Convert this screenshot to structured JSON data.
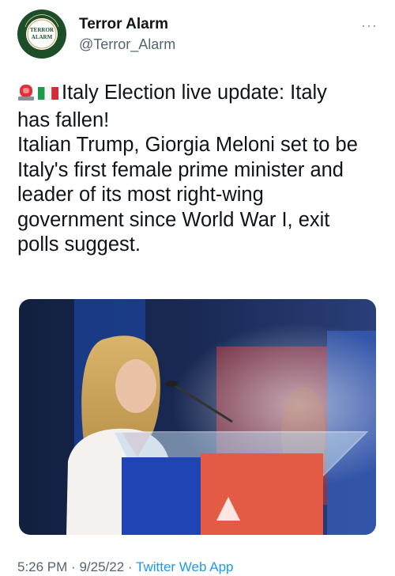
{
  "author": {
    "display_name": "Terror Alarm",
    "handle": "@Terror_Alarm",
    "avatar_text_top": "TERROR",
    "avatar_text_bottom": "ALARM",
    "avatar_ring_text": "TERROR ALARM"
  },
  "more_label": "···",
  "tweet": {
    "lines": [
      "Italy Election live update: Italy",
      "has fallen!",
      "Italian Trump, Giorgia Meloni set to be",
      "Italy's first female prime minister and",
      "leader of its most right-wing",
      "government since World War I, exit",
      "polls suggest."
    ],
    "emojis": [
      "siren-emoji",
      "italy-flag-emoji"
    ]
  },
  "media": {
    "description_icon": "photo"
  },
  "meta": {
    "time": "5:26 PM",
    "separator": "·",
    "date": "9/25/22",
    "source": "Twitter Web App"
  },
  "colors": {
    "text": "#0f1419",
    "secondary": "#536471",
    "link": "#1d9bf0",
    "avatar_green": "#1d4e2a"
  }
}
